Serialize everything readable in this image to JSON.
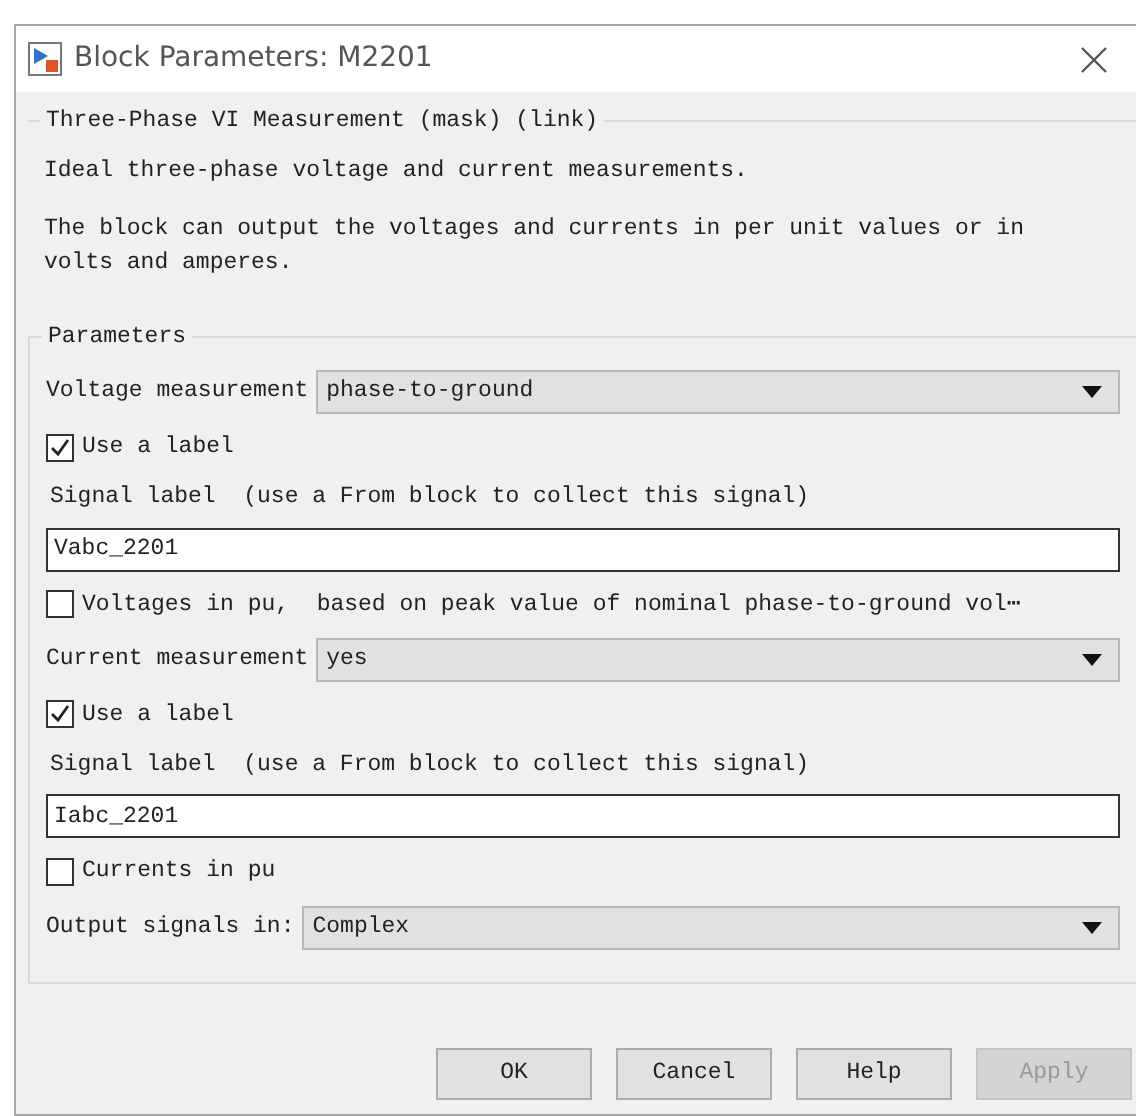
{
  "window": {
    "title": "Block Parameters: M2201"
  },
  "description": {
    "title": "Three-Phase VI Measurement (mask) (link)",
    "paragraphs": [
      "Ideal three-phase voltage and current measurements.",
      "The block can output the voltages and currents in per unit values or in volts and amperes."
    ]
  },
  "parameters": {
    "title": "Parameters",
    "items": [
      {
        "kind": "select",
        "label": "Voltage measurement",
        "value": "phase-to-ground"
      },
      {
        "kind": "checkbox",
        "label": "Use a label",
        "checked": true
      },
      {
        "kind": "text",
        "label": "Signal label  (use a From block to collect this signal)",
        "value": "Vabc_2201"
      },
      {
        "kind": "checkbox",
        "label": "Voltages in pu,  based on peak value of nominal phase-to-ground vol⋯",
        "checked": false
      },
      {
        "kind": "select",
        "label": "Current measurement",
        "value": "yes"
      },
      {
        "kind": "checkbox",
        "label": "Use a label",
        "checked": true
      },
      {
        "kind": "text",
        "label": "Signal label  (use a From block to collect this signal)",
        "value": "Iabc_2201"
      },
      {
        "kind": "checkbox",
        "label": "Currents in pu",
        "checked": false
      },
      {
        "kind": "select",
        "label": "Output signals in:",
        "value": "Complex"
      }
    ]
  },
  "buttons": [
    {
      "label": "OK",
      "disabled": false
    },
    {
      "label": "Cancel",
      "disabled": false
    },
    {
      "label": "Help",
      "disabled": false
    },
    {
      "label": "Apply",
      "disabled": true
    }
  ]
}
